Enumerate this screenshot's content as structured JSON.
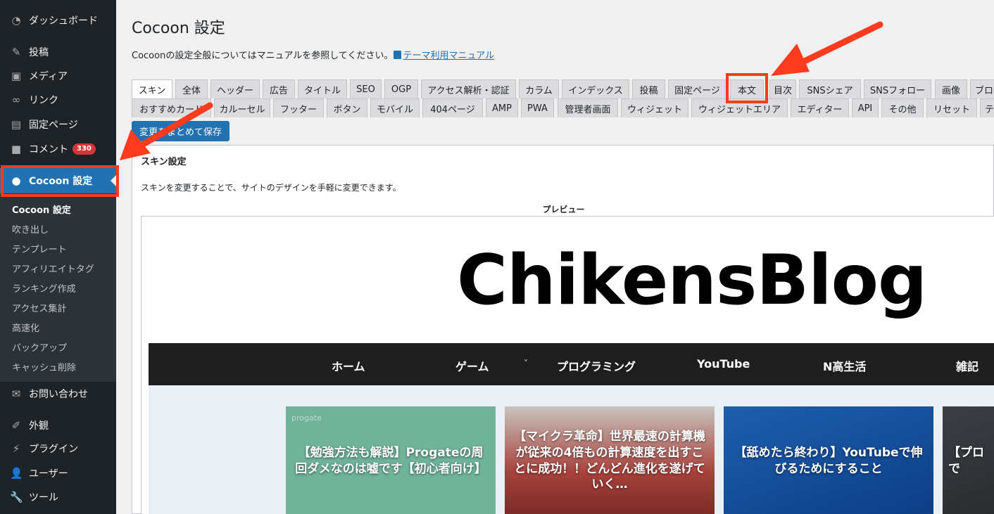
{
  "sidebar": {
    "items": [
      {
        "label": "ダッシュボード",
        "icon": "dashboard-icon"
      },
      {
        "label": "投稿",
        "icon": "pin-icon"
      },
      {
        "label": "メディア",
        "icon": "media-icon"
      },
      {
        "label": "リンク",
        "icon": "link-icon"
      },
      {
        "label": "固定ページ",
        "icon": "page-icon"
      },
      {
        "label": "コメント",
        "icon": "comment-icon",
        "badge": "330"
      },
      {
        "label": "Cocoon 設定",
        "icon": "cocoon-icon"
      },
      {
        "label": "お問い合わせ",
        "icon": "mail-icon"
      },
      {
        "label": "外観",
        "icon": "brush-icon"
      },
      {
        "label": "プラグイン",
        "icon": "plugin-icon"
      },
      {
        "label": "ユーザー",
        "icon": "user-icon"
      },
      {
        "label": "ツール",
        "icon": "wrench-icon"
      }
    ],
    "submenu": [
      "Cocoon 設定",
      "吹き出し",
      "テンプレート",
      "アフィリエイトタグ",
      "ランキング作成",
      "アクセス集計",
      "高速化",
      "バックアップ",
      "キャッシュ削除"
    ]
  },
  "main": {
    "title": "Cocoon 設定",
    "intro_text": "Cocoonの設定全般についてはマニュアルを参照してください。",
    "manual_link": "テーマ利用マニュアル",
    "tabs_row1": [
      "スキン",
      "全体",
      "ヘッダー",
      "広告",
      "タイトル",
      "SEO",
      "OGP",
      "アクセス解析・認証",
      "カラム",
      "インデックス",
      "投稿",
      "固定ページ",
      "本文",
      "目次",
      "SNSシェア",
      "SNSフォロー",
      "画像",
      "ブロ"
    ],
    "tabs_row2": [
      "おすすめカード",
      "カルーセル",
      "フッター",
      "ボタン",
      "モバイル",
      "404ページ",
      "AMP",
      "PWA",
      "管理者画面",
      "ウィジェット",
      "ウィジェットエリア",
      "エディター",
      "API",
      "その他",
      "リセット",
      "テ"
    ],
    "save_button": "変更をまとめて保存",
    "panel_heading": "スキン設定",
    "panel_desc": "スキンを変更することで、サイトのデザインを手軽に変更できます。",
    "preview_label": "プレビュー"
  },
  "preview": {
    "logo": "ChikensBlog",
    "nav": [
      "ホーム",
      "ゲーム",
      "プログラミング",
      "YouTube",
      "N高生活",
      "雑記"
    ],
    "nav_caret": "˅",
    "cards": [
      {
        "title": "【勉強方法も解説】Progateの周回ダメなのは嘘です【初心者向け】",
        "deco": "progate"
      },
      {
        "title": "【マイクラ革命】世界最速の計算機が従来の4倍もの計算速度を出すことに成功！！どんどん進化を遂げていく…",
        "deco": ""
      },
      {
        "title": "【舐めたら終わり】YouTubeで伸びるためにすること",
        "deco": ""
      },
      {
        "title": "【プロ で",
        "deco": ""
      }
    ]
  },
  "colors": {
    "sidebar_bg": "#1d2327",
    "active_blue": "#2271b1",
    "highlight_red": "#ff3b1f",
    "badge_red": "#d63638"
  }
}
